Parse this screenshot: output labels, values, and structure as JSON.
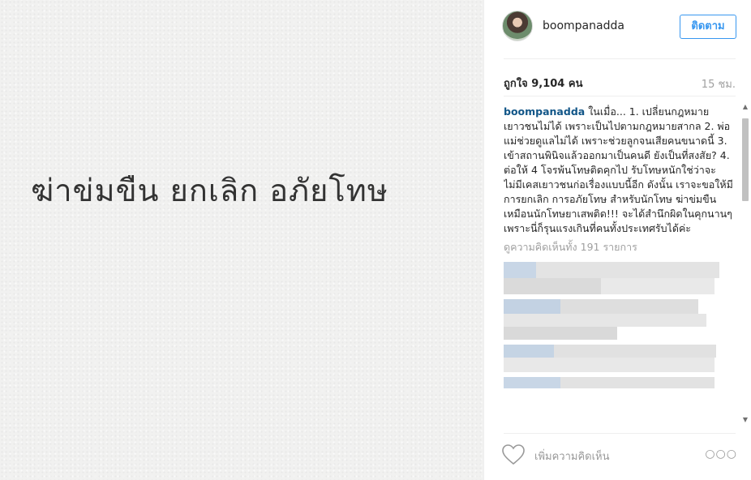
{
  "post": {
    "image_text": "ฆ่าข่มขืน ยกเลิก อภัยโทษ"
  },
  "header": {
    "username": "boompanadda",
    "follow_label": "ติดตาม"
  },
  "stats": {
    "likes": "ถูกใจ 9,104 คน",
    "time_ago": "15 ชม."
  },
  "caption": {
    "username": "boompanadda",
    "text": "ในเมื่อ... 1. เปลี่ยนกฎหมายเยาวชนไม่ได้ เพราะเป็นไปตามกฎหมายสากล 2. พ่อแม่ช่วยดูแลไม่ได้ เพราะช่วยลูกจนเสียคนขนาดนี้ 3. เข้าสถานพินิจแล้วออกมาเป็นคนดี ยังเป็นที่สงสัย? 4. ต่อให้ 4 โจรพ้นโทษติดคุกไป รับโทษหนักใช่ว่าจะไม่มีเคสเยาวชนก่อเรื่องแบบนี้อีก ดังนั้น เราจะขอให้มีการยกเลิก การอภัยโทษ สำหรับนักโทษ ฆ่าข่มขืน เหมือนนักโทษยาเสพติด!!! จะได้สำนึกผิดในคุกนานๆ เพราะนี่ก็รุนแรงเกินที่คนทั้งประเทศรับได้ค่ะ"
  },
  "comments": {
    "view_all_label": "ดูความคิดเห็นทั้ง 191 รายการ"
  },
  "footer": {
    "comment_placeholder": "เพิ่มความคิดเห็น",
    "more_label": "○○○"
  },
  "colors": {
    "accent": "#3897f0",
    "username": "#125688",
    "muted": "#a0a0a0"
  }
}
